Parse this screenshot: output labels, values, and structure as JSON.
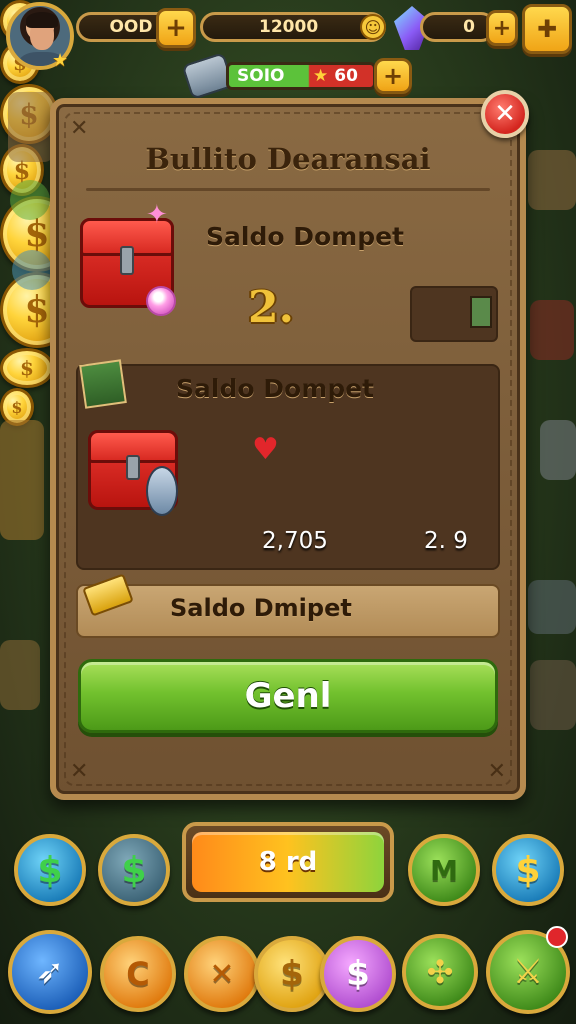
{
  "hud": {
    "coins_value": "OOD",
    "score_value": "12000",
    "gems_value": "0",
    "energy_value": "SOIO",
    "stars_value": "60"
  },
  "dialog": {
    "title": "Bullito Dearansai",
    "wallet_label": "Saldo Dompet",
    "wallet_amount": "2.",
    "section_label": "Saldo Dompet",
    "value_left": "2,705",
    "value_right": "2. 9",
    "bar_label": "Saldo Dmipet",
    "primary_button": "Genl"
  },
  "bottom": {
    "center_button": "8 rd"
  },
  "icons": {
    "close": "close-icon",
    "coin": "dollar-coin-icon",
    "chest": "treasure-chest-icon",
    "heart": "heart-icon",
    "gem": "gem-icon"
  },
  "colors": {
    "panel": "#7a5a37",
    "primary_green": "#72c12e",
    "close_red": "#d4261f",
    "gold": "#ffd43b"
  }
}
